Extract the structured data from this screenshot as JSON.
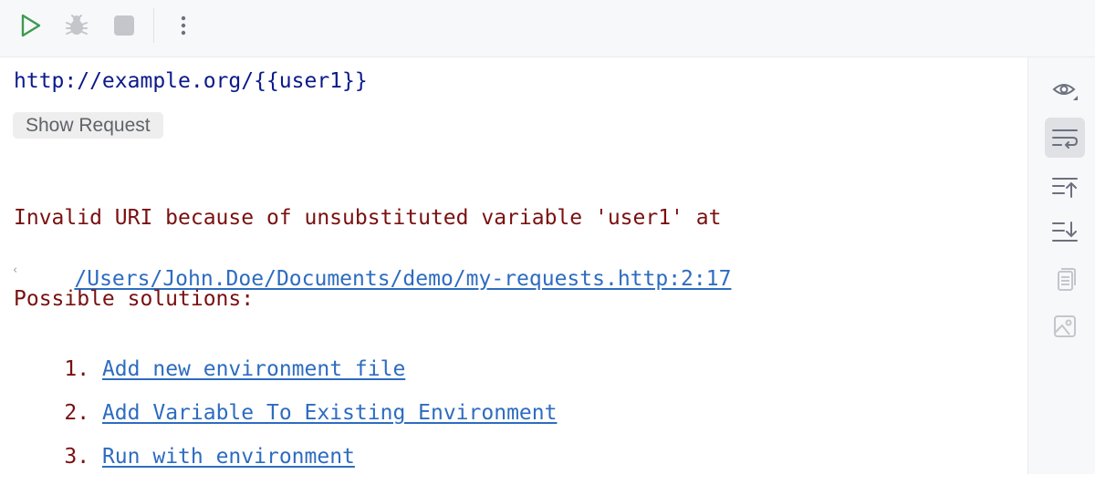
{
  "toolbar": {
    "run_icon": "run-icon",
    "debug_icon": "debug-icon",
    "stop_icon": "stop-icon",
    "more_icon": "more-vertical-icon"
  },
  "editor": {
    "request_url": "http://example.org/{{user1}}",
    "show_request_label": "Show Request",
    "error_prefix": "Invalid URI because of unsubstituted variable 'user1' at",
    "error_location_link": "/Users/John.Doe/Documents/demo/my-requests.http:2:17",
    "solutions_heading": "Possible solutions:",
    "solutions": [
      {
        "number": "1.",
        "label": "Add new environment file"
      },
      {
        "number": "2.",
        "label": "Add Variable To Existing Environment"
      },
      {
        "number": "3.",
        "label": "Run with environment"
      }
    ]
  },
  "sidebar": {
    "items": [
      {
        "icon": "eye-icon"
      },
      {
        "icon": "soft-wrap-icon",
        "active": true
      },
      {
        "icon": "scroll-to-top-icon"
      },
      {
        "icon": "scroll-to-end-icon"
      },
      {
        "icon": "copy-icon"
      },
      {
        "icon": "image-icon"
      }
    ]
  },
  "colors": {
    "url": "#0b1a8a",
    "error": "#7a1010",
    "link": "#2d6cc0",
    "run_green": "#3d9a50"
  }
}
